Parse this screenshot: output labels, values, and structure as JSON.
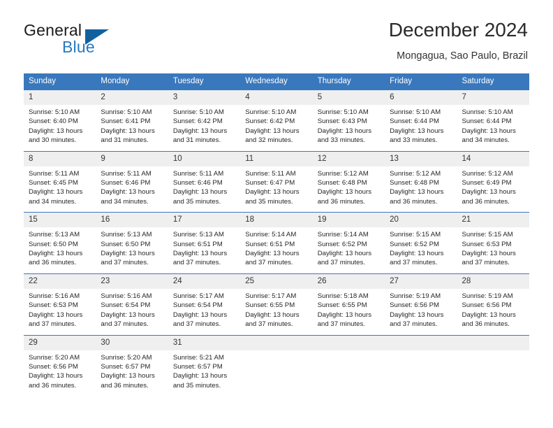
{
  "brand": {
    "name_part1": "General",
    "name_part2": "Blue",
    "logo_icon": "triangle-icon",
    "colors": {
      "dark": "#1b1b1b",
      "blue": "#2779c0",
      "triangle": "#12619f"
    }
  },
  "header": {
    "title": "December 2024",
    "subtitle": "Mongagua, Sao Paulo, Brazil"
  },
  "theme": {
    "header_blue": "#3a78bd",
    "daynum_band": "#efefef",
    "cell_background": "#ffffff",
    "text": "#262626"
  },
  "weekdays": [
    "Sunday",
    "Monday",
    "Tuesday",
    "Wednesday",
    "Thursday",
    "Friday",
    "Saturday"
  ],
  "weeks": [
    [
      {
        "day": "1",
        "sunrise": "Sunrise: 5:10 AM",
        "sunset": "Sunset: 6:40 PM",
        "daylight": "Daylight: 13 hours and 30 minutes."
      },
      {
        "day": "2",
        "sunrise": "Sunrise: 5:10 AM",
        "sunset": "Sunset: 6:41 PM",
        "daylight": "Daylight: 13 hours and 31 minutes."
      },
      {
        "day": "3",
        "sunrise": "Sunrise: 5:10 AM",
        "sunset": "Sunset: 6:42 PM",
        "daylight": "Daylight: 13 hours and 31 minutes."
      },
      {
        "day": "4",
        "sunrise": "Sunrise: 5:10 AM",
        "sunset": "Sunset: 6:42 PM",
        "daylight": "Daylight: 13 hours and 32 minutes."
      },
      {
        "day": "5",
        "sunrise": "Sunrise: 5:10 AM",
        "sunset": "Sunset: 6:43 PM",
        "daylight": "Daylight: 13 hours and 33 minutes."
      },
      {
        "day": "6",
        "sunrise": "Sunrise: 5:10 AM",
        "sunset": "Sunset: 6:44 PM",
        "daylight": "Daylight: 13 hours and 33 minutes."
      },
      {
        "day": "7",
        "sunrise": "Sunrise: 5:10 AM",
        "sunset": "Sunset: 6:44 PM",
        "daylight": "Daylight: 13 hours and 34 minutes."
      }
    ],
    [
      {
        "day": "8",
        "sunrise": "Sunrise: 5:11 AM",
        "sunset": "Sunset: 6:45 PM",
        "daylight": "Daylight: 13 hours and 34 minutes."
      },
      {
        "day": "9",
        "sunrise": "Sunrise: 5:11 AM",
        "sunset": "Sunset: 6:46 PM",
        "daylight": "Daylight: 13 hours and 34 minutes."
      },
      {
        "day": "10",
        "sunrise": "Sunrise: 5:11 AM",
        "sunset": "Sunset: 6:46 PM",
        "daylight": "Daylight: 13 hours and 35 minutes."
      },
      {
        "day": "11",
        "sunrise": "Sunrise: 5:11 AM",
        "sunset": "Sunset: 6:47 PM",
        "daylight": "Daylight: 13 hours and 35 minutes."
      },
      {
        "day": "12",
        "sunrise": "Sunrise: 5:12 AM",
        "sunset": "Sunset: 6:48 PM",
        "daylight": "Daylight: 13 hours and 36 minutes."
      },
      {
        "day": "13",
        "sunrise": "Sunrise: 5:12 AM",
        "sunset": "Sunset: 6:48 PM",
        "daylight": "Daylight: 13 hours and 36 minutes."
      },
      {
        "day": "14",
        "sunrise": "Sunrise: 5:12 AM",
        "sunset": "Sunset: 6:49 PM",
        "daylight": "Daylight: 13 hours and 36 minutes."
      }
    ],
    [
      {
        "day": "15",
        "sunrise": "Sunrise: 5:13 AM",
        "sunset": "Sunset: 6:50 PM",
        "daylight": "Daylight: 13 hours and 36 minutes."
      },
      {
        "day": "16",
        "sunrise": "Sunrise: 5:13 AM",
        "sunset": "Sunset: 6:50 PM",
        "daylight": "Daylight: 13 hours and 37 minutes."
      },
      {
        "day": "17",
        "sunrise": "Sunrise: 5:13 AM",
        "sunset": "Sunset: 6:51 PM",
        "daylight": "Daylight: 13 hours and 37 minutes."
      },
      {
        "day": "18",
        "sunrise": "Sunrise: 5:14 AM",
        "sunset": "Sunset: 6:51 PM",
        "daylight": "Daylight: 13 hours and 37 minutes."
      },
      {
        "day": "19",
        "sunrise": "Sunrise: 5:14 AM",
        "sunset": "Sunset: 6:52 PM",
        "daylight": "Daylight: 13 hours and 37 minutes."
      },
      {
        "day": "20",
        "sunrise": "Sunrise: 5:15 AM",
        "sunset": "Sunset: 6:52 PM",
        "daylight": "Daylight: 13 hours and 37 minutes."
      },
      {
        "day": "21",
        "sunrise": "Sunrise: 5:15 AM",
        "sunset": "Sunset: 6:53 PM",
        "daylight": "Daylight: 13 hours and 37 minutes."
      }
    ],
    [
      {
        "day": "22",
        "sunrise": "Sunrise: 5:16 AM",
        "sunset": "Sunset: 6:53 PM",
        "daylight": "Daylight: 13 hours and 37 minutes."
      },
      {
        "day": "23",
        "sunrise": "Sunrise: 5:16 AM",
        "sunset": "Sunset: 6:54 PM",
        "daylight": "Daylight: 13 hours and 37 minutes."
      },
      {
        "day": "24",
        "sunrise": "Sunrise: 5:17 AM",
        "sunset": "Sunset: 6:54 PM",
        "daylight": "Daylight: 13 hours and 37 minutes."
      },
      {
        "day": "25",
        "sunrise": "Sunrise: 5:17 AM",
        "sunset": "Sunset: 6:55 PM",
        "daylight": "Daylight: 13 hours and 37 minutes."
      },
      {
        "day": "26",
        "sunrise": "Sunrise: 5:18 AM",
        "sunset": "Sunset: 6:55 PM",
        "daylight": "Daylight: 13 hours and 37 minutes."
      },
      {
        "day": "27",
        "sunrise": "Sunrise: 5:19 AM",
        "sunset": "Sunset: 6:56 PM",
        "daylight": "Daylight: 13 hours and 37 minutes."
      },
      {
        "day": "28",
        "sunrise": "Sunrise: 5:19 AM",
        "sunset": "Sunset: 6:56 PM",
        "daylight": "Daylight: 13 hours and 36 minutes."
      }
    ],
    [
      {
        "day": "29",
        "sunrise": "Sunrise: 5:20 AM",
        "sunset": "Sunset: 6:56 PM",
        "daylight": "Daylight: 13 hours and 36 minutes."
      },
      {
        "day": "30",
        "sunrise": "Sunrise: 5:20 AM",
        "sunset": "Sunset: 6:57 PM",
        "daylight": "Daylight: 13 hours and 36 minutes."
      },
      {
        "day": "31",
        "sunrise": "Sunrise: 5:21 AM",
        "sunset": "Sunset: 6:57 PM",
        "daylight": "Daylight: 13 hours and 35 minutes."
      },
      {
        "day": "",
        "sunrise": "",
        "sunset": "",
        "daylight": ""
      },
      {
        "day": "",
        "sunrise": "",
        "sunset": "",
        "daylight": ""
      },
      {
        "day": "",
        "sunrise": "",
        "sunset": "",
        "daylight": ""
      },
      {
        "day": "",
        "sunrise": "",
        "sunset": "",
        "daylight": ""
      }
    ]
  ]
}
